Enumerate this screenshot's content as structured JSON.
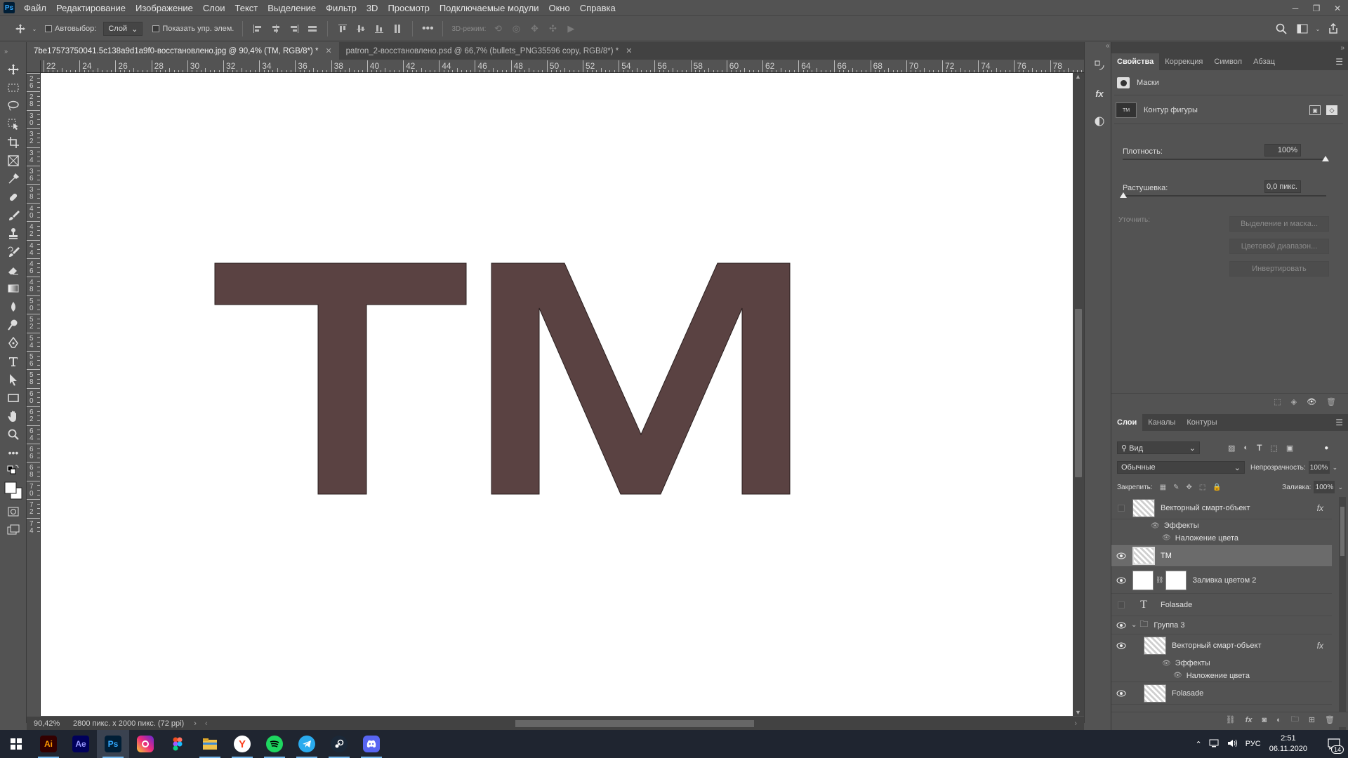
{
  "menubar": {
    "logo": "Ps",
    "items": [
      "Файл",
      "Редактирование",
      "Изображение",
      "Слои",
      "Текст",
      "Выделение",
      "Фильтр",
      "3D",
      "Просмотр",
      "Подключаемые модули",
      "Окно",
      "Справка"
    ]
  },
  "options": {
    "autoselect_label": "Автовыбор:",
    "autoselect_value": "Слой",
    "show_controls_label": "Показать упр. элем.",
    "mode_3d_label": "3D-режим:"
  },
  "tabs": [
    {
      "label": "7be17573750041.5c138a9d1a9f0-восстановлено.jpg @ 90,4% (TM, RGB/8*) *",
      "active": true
    },
    {
      "label": "patron_2-восстановлено.psd @ 66,7% (bullets_PNG35596 copy, RGB/8*) *",
      "active": false
    }
  ],
  "ruler": {
    "top_ticks": [
      "22",
      "24",
      "26",
      "28",
      "30",
      "32",
      "34",
      "36",
      "38",
      "40",
      "42",
      "44",
      "46",
      "48",
      "50",
      "52",
      "54",
      "56",
      "58",
      "60",
      "62",
      "64",
      "66",
      "68",
      "70",
      "72",
      "74",
      "76",
      "78"
    ],
    "left_ticks": [
      "2\n6",
      "2\n8",
      "3\n0",
      "3\n2",
      "3\n4",
      "3\n6",
      "3\n8",
      "4\n0",
      "4\n2",
      "4\n4",
      "4\n6",
      "4\n8",
      "5\n0",
      "5\n2",
      "5\n4",
      "5\n6",
      "5\n8",
      "6\n0",
      "6\n2",
      "6\n4",
      "6\n6",
      "6\n8",
      "7\n0",
      "7\n2",
      "7\n4"
    ]
  },
  "canvas": {
    "artwork_text": "TM",
    "fill_color": "#5a4242"
  },
  "statusbar": {
    "zoom": "90,42%",
    "doc_info": "2800 пикс. x 2000 пикс. (72 ppi)"
  },
  "properties": {
    "tabs": [
      "Свойства",
      "Коррекция",
      "Символ",
      "Абзац"
    ],
    "masks_label": "Маски",
    "shape_thumb_text": "TM",
    "shape_label": "Контур фигуры",
    "density_label": "Плотность:",
    "density_value": "100%",
    "feather_label": "Растушевка:",
    "feather_value": "0,0 пикс.",
    "refine_label": "Уточнить:",
    "btn_select_mask": "Выделение и маска...",
    "btn_color_range": "Цветовой диапазон...",
    "btn_invert": "Инвертировать"
  },
  "layers_panel": {
    "tabs": [
      "Слои",
      "Каналы",
      "Контуры"
    ],
    "filter_label": "Вид",
    "blend_mode": "Обычные",
    "opacity_label": "Непрозрачность:",
    "opacity_value": "100%",
    "lock_label": "Закрепить:",
    "fill_label": "Заливка:",
    "fill_value": "100%",
    "layers": [
      {
        "name": "Векторный смарт-объект",
        "fx": "fx"
      },
      {
        "name": "Эффекты"
      },
      {
        "name": "Наложение цвета"
      },
      {
        "name": "TM"
      },
      {
        "name": "Заливка цветом 2"
      },
      {
        "name": "Folasade"
      },
      {
        "name": "Группа 3"
      },
      {
        "name": "Векторный смарт-объект",
        "fx": "fx"
      },
      {
        "name": "Эффекты"
      },
      {
        "name": "Наложение цвета"
      },
      {
        "name": "Folasade"
      }
    ]
  },
  "taskbar": {
    "apps": [
      {
        "name": "Ai",
        "bg": "#330000",
        "fg": "#ff9a00"
      },
      {
        "name": "Ae",
        "bg": "#00005b",
        "fg": "#9999ff"
      },
      {
        "name": "Ps",
        "bg": "#001e36",
        "fg": "#31a8ff"
      }
    ],
    "lang": "РУС",
    "time": "2:51",
    "date": "06.11.2020",
    "notif_count": "14"
  }
}
